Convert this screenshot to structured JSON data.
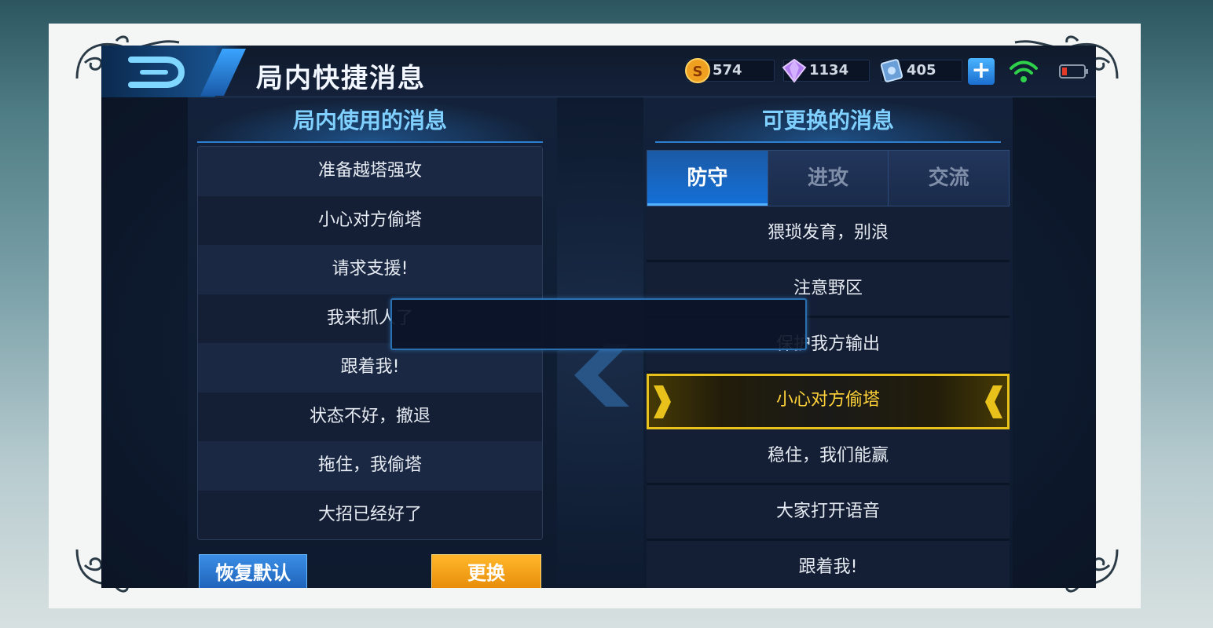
{
  "header": {
    "title": "局内快捷消息",
    "back_icon": "back-arrow-icon"
  },
  "resources": {
    "gold": "574",
    "diamond": "1134",
    "coupon": "405"
  },
  "left_panel": {
    "title": "局内使用的消息",
    "items": [
      "准备越塔强攻",
      "小心对方偷塔",
      "请求支援!",
      "我来抓人了",
      "跟着我!",
      "状态不好，撤退",
      "拖住，我偷塔",
      "大招已经好了"
    ],
    "restore_label": "恢复默认",
    "change_label": "更换"
  },
  "right_panel": {
    "title": "可更换的消息",
    "tabs": [
      "防守",
      "进攻",
      "交流"
    ],
    "active_tab": "防守",
    "items": [
      "猥琐发育，别浪",
      "注意野区",
      "保护我方输出",
      "小心对方偷塔",
      "稳住，我们能赢",
      "大家打开语音",
      "跟着我!"
    ],
    "selected_item": "小心对方偷塔"
  },
  "colors": {
    "accent_blue": "#7fd0ff",
    "selected_gold": "#e8c21a",
    "change_button": "#f0a01a"
  }
}
